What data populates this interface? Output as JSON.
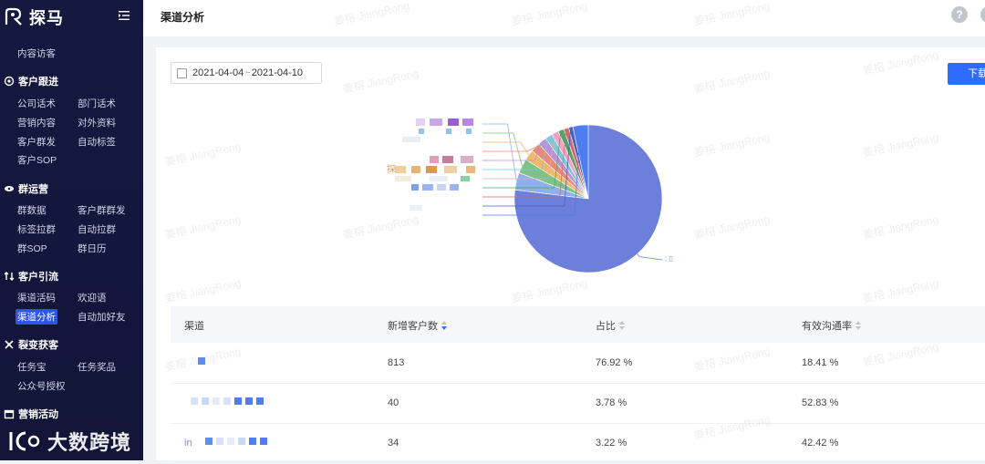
{
  "app": {
    "name": "探马"
  },
  "header": {
    "title": "渠道分析"
  },
  "sidebar": {
    "top_item": "内容访客",
    "sections": [
      {
        "title": "客户跟进",
        "items": [
          "公司话术",
          "部门话术",
          "营销内容",
          "对外资料",
          "客户群发",
          "自动标签",
          "客户SOP"
        ]
      },
      {
        "title": "群运营",
        "items": [
          "群数据",
          "客户群群发",
          "标签拉群",
          "自动拉群",
          "群SOP",
          "群日历"
        ]
      },
      {
        "title": "客户引流",
        "items": [
          "渠道活码",
          "欢迎语",
          "渠道分析",
          "自动加好友"
        ]
      },
      {
        "title": "裂变获客",
        "items": [
          "任务宝",
          "任务奖品",
          "公众号授权"
        ]
      },
      {
        "title": "营销活动",
        "items": []
      }
    ],
    "active_item": "渠道分析"
  },
  "watermark_brand": "大数跨境",
  "background_watermark": "姜榕 JiangRong",
  "filters": {
    "date_start": "2021-04-04",
    "date_separator": "~",
    "date_end": "2021-04-10"
  },
  "toolbar": {
    "download_label": "下载"
  },
  "colors": {
    "accent": "#2f6bff",
    "sidebar_bg": "#15193f",
    "pie_main": "#6b7fdb"
  },
  "chart_data": {
    "type": "pie",
    "slices": [
      {
        "value": 76.92,
        "color": "#6b7fdb"
      },
      {
        "value": 3.78,
        "color": "#8fb0ea"
      },
      {
        "value": 3.22,
        "color": "#7cc389"
      },
      {
        "value": 2.3,
        "color": "#f0b86a"
      },
      {
        "value": 2.1,
        "color": "#e88a7a"
      },
      {
        "value": 1.9,
        "color": "#b794d6"
      },
      {
        "value": 1.6,
        "color": "#7fc8d8"
      },
      {
        "value": 1.5,
        "color": "#f2a0c6"
      },
      {
        "value": 1.3,
        "color": "#5aa06b"
      },
      {
        "value": 1.1,
        "color": "#d16b6b"
      },
      {
        "value": 0.9,
        "color": "#4a5fc1"
      },
      {
        "value": 3.37,
        "color": "#4f7df0"
      }
    ],
    "main_label": "; ▯"
  },
  "table": {
    "columns": [
      "渠道",
      "新增客户数",
      "占比",
      "有效沟通率"
    ],
    "rows": [
      {
        "channel": "",
        "new_customers": "813",
        "ratio": "76.92 %",
        "effective_rate": "18.41 %"
      },
      {
        "channel": "",
        "new_customers": "40",
        "ratio": "3.78 %",
        "effective_rate": "52.83 %"
      },
      {
        "channel": "in",
        "new_customers": "34",
        "ratio": "3.22 %",
        "effective_rate": "42.42 %"
      }
    ]
  }
}
